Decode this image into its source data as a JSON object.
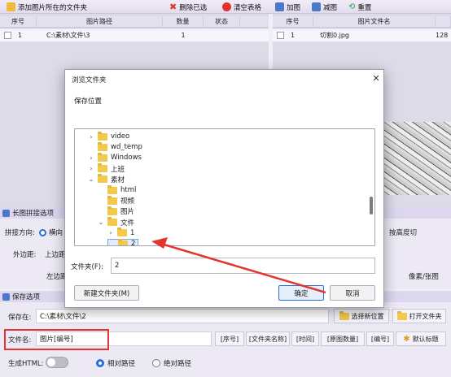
{
  "toolbar": {
    "add_folder": "添加图片所在的文件夹",
    "delete_selected": "删除已选",
    "clear_table": "清空表格",
    "zoom_in": "加图",
    "zoom_out": "减图",
    "reset": "重置"
  },
  "left_table": {
    "headers": [
      "序号",
      "图片路径",
      "数量",
      "状态"
    ],
    "rows": [
      {
        "index": "1",
        "path": "C:\\素材\\文件\\3",
        "count": "1",
        "status": ""
      }
    ]
  },
  "right_table": {
    "headers": [
      "序号",
      "图片文件名",
      ""
    ],
    "rows": [
      {
        "index": "1",
        "name": "切割0.jpg",
        "extra": "128"
      }
    ]
  },
  "long_image_section": {
    "title": "长图拼接选项",
    "direction_label": "拼接方向:",
    "direction_value": "横向",
    "margin_label": "外边距:",
    "margin_sub1": "上边距",
    "margin_sub2": "左边距",
    "auto_height_label": "按高度切",
    "unit_label": "像素/张图"
  },
  "save_section": {
    "title": "保存选项",
    "save_to_label": "保存在:",
    "save_to_value": "C:\\素材\\文件\\2",
    "choose_location": "选择新位置",
    "open_folder": "打开文件夹",
    "filename_label": "文件名:",
    "filename_value": "图片[编号]",
    "tokens": [
      "[序号]",
      "[文件夹名称]",
      "[时间]",
      "[原图数量]",
      "[编号]"
    ],
    "default_title": "默认标题",
    "html_label": "生成HTML:",
    "relative_path": "相对路径",
    "absolute_path": "绝对路径"
  },
  "dialog": {
    "title": "浏览文件夹",
    "heading": "保存位置",
    "tree": [
      {
        "label": "video",
        "level": 1,
        "arrow": ">"
      },
      {
        "label": "wd_temp",
        "level": 1,
        "arrow": ""
      },
      {
        "label": "Windows",
        "level": 1,
        "arrow": ">"
      },
      {
        "label": "上班",
        "level": 1,
        "arrow": ">"
      },
      {
        "label": "素材",
        "level": 1,
        "arrow": "v"
      },
      {
        "label": "html",
        "level": 2,
        "arrow": ""
      },
      {
        "label": "视频",
        "level": 2,
        "arrow": ""
      },
      {
        "label": "图片",
        "level": 2,
        "arrow": ""
      },
      {
        "label": "文件",
        "level": 2,
        "arrow": "v"
      },
      {
        "label": "1",
        "level": 3,
        "arrow": ">"
      },
      {
        "label": "2",
        "level": 3,
        "arrow": ""
      }
    ],
    "folder_label": "文件夹(F):",
    "folder_value": "2",
    "new_folder": "新建文件夹(M)",
    "ok": "确定",
    "cancel": "取消"
  },
  "colors": {
    "accent": "#e3342f",
    "highlight": "#e2ecfb",
    "section": "#dcd6ef"
  }
}
